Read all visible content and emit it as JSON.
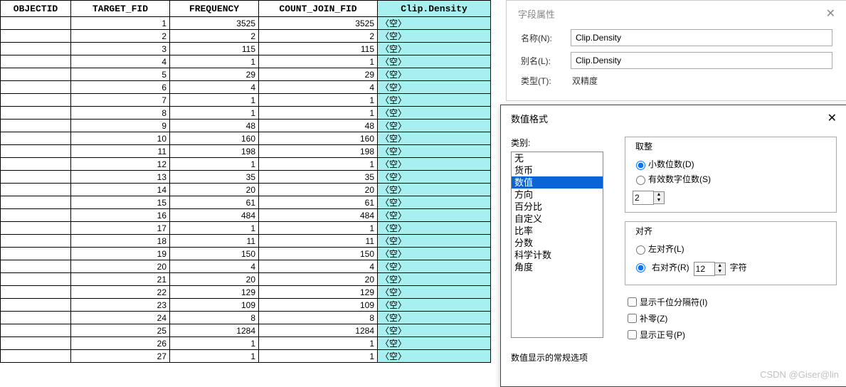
{
  "table": {
    "headers": [
      "OBJECTID",
      "TARGET_FID",
      "FREQUENCY",
      "COUNT_JOIN_FID",
      "Clip.Density"
    ],
    "empty_label": "〈空〉",
    "rows": [
      {
        "target": 1,
        "freq": 3525,
        "count": 3525
      },
      {
        "target": 2,
        "freq": 2,
        "count": 2
      },
      {
        "target": 3,
        "freq": 115,
        "count": 115
      },
      {
        "target": 4,
        "freq": 1,
        "count": 1
      },
      {
        "target": 5,
        "freq": 29,
        "count": 29
      },
      {
        "target": 6,
        "freq": 4,
        "count": 4
      },
      {
        "target": 7,
        "freq": 1,
        "count": 1
      },
      {
        "target": 8,
        "freq": 1,
        "count": 1
      },
      {
        "target": 9,
        "freq": 48,
        "count": 48
      },
      {
        "target": 10,
        "freq": 160,
        "count": 160
      },
      {
        "target": 11,
        "freq": 198,
        "count": 198
      },
      {
        "target": 12,
        "freq": 1,
        "count": 1
      },
      {
        "target": 13,
        "freq": 35,
        "count": 35
      },
      {
        "target": 14,
        "freq": 20,
        "count": 20
      },
      {
        "target": 15,
        "freq": 61,
        "count": 61
      },
      {
        "target": 16,
        "freq": 484,
        "count": 484
      },
      {
        "target": 17,
        "freq": 1,
        "count": 1
      },
      {
        "target": 18,
        "freq": 11,
        "count": 11
      },
      {
        "target": 19,
        "freq": 150,
        "count": 150
      },
      {
        "target": 20,
        "freq": 4,
        "count": 4
      },
      {
        "target": 21,
        "freq": 20,
        "count": 20
      },
      {
        "target": 22,
        "freq": 129,
        "count": 129
      },
      {
        "target": 23,
        "freq": 109,
        "count": 109
      },
      {
        "target": 24,
        "freq": 8,
        "count": 8
      },
      {
        "target": 25,
        "freq": 1284,
        "count": 1284
      },
      {
        "target": 26,
        "freq": 1,
        "count": 1
      },
      {
        "target": 27,
        "freq": 1,
        "count": 1
      }
    ]
  },
  "field_props": {
    "title": "字段属性",
    "name_label": "名称(N):",
    "name_value": "Clip.Density",
    "alias_label": "别名(L):",
    "alias_value": "Clip.Density",
    "type_label": "类型(T):",
    "type_value": "双精度"
  },
  "number_format": {
    "title": "数值格式",
    "category_label": "类别:",
    "categories": [
      "无",
      "货币",
      "数值",
      "方向",
      "百分比",
      "自定义",
      "比率",
      "分数",
      "科学计数",
      "角度"
    ],
    "selected_index": 2,
    "rounding": {
      "title": "取整",
      "decimal_places": "小数位数(D)",
      "significant_digits": "有效数字位数(S)",
      "value": "2"
    },
    "alignment": {
      "title": "对齐",
      "left": "左对齐(L)",
      "right": "右对齐(R)",
      "chars_value": "12",
      "chars_label": "字符"
    },
    "show_thousands": "显示千位分隔符(I)",
    "pad_zeros": "补零(Z)",
    "show_plus": "显示正号(P)",
    "general_label": "数值显示的常规选项"
  },
  "watermark": "CSDN @Giser@lin"
}
